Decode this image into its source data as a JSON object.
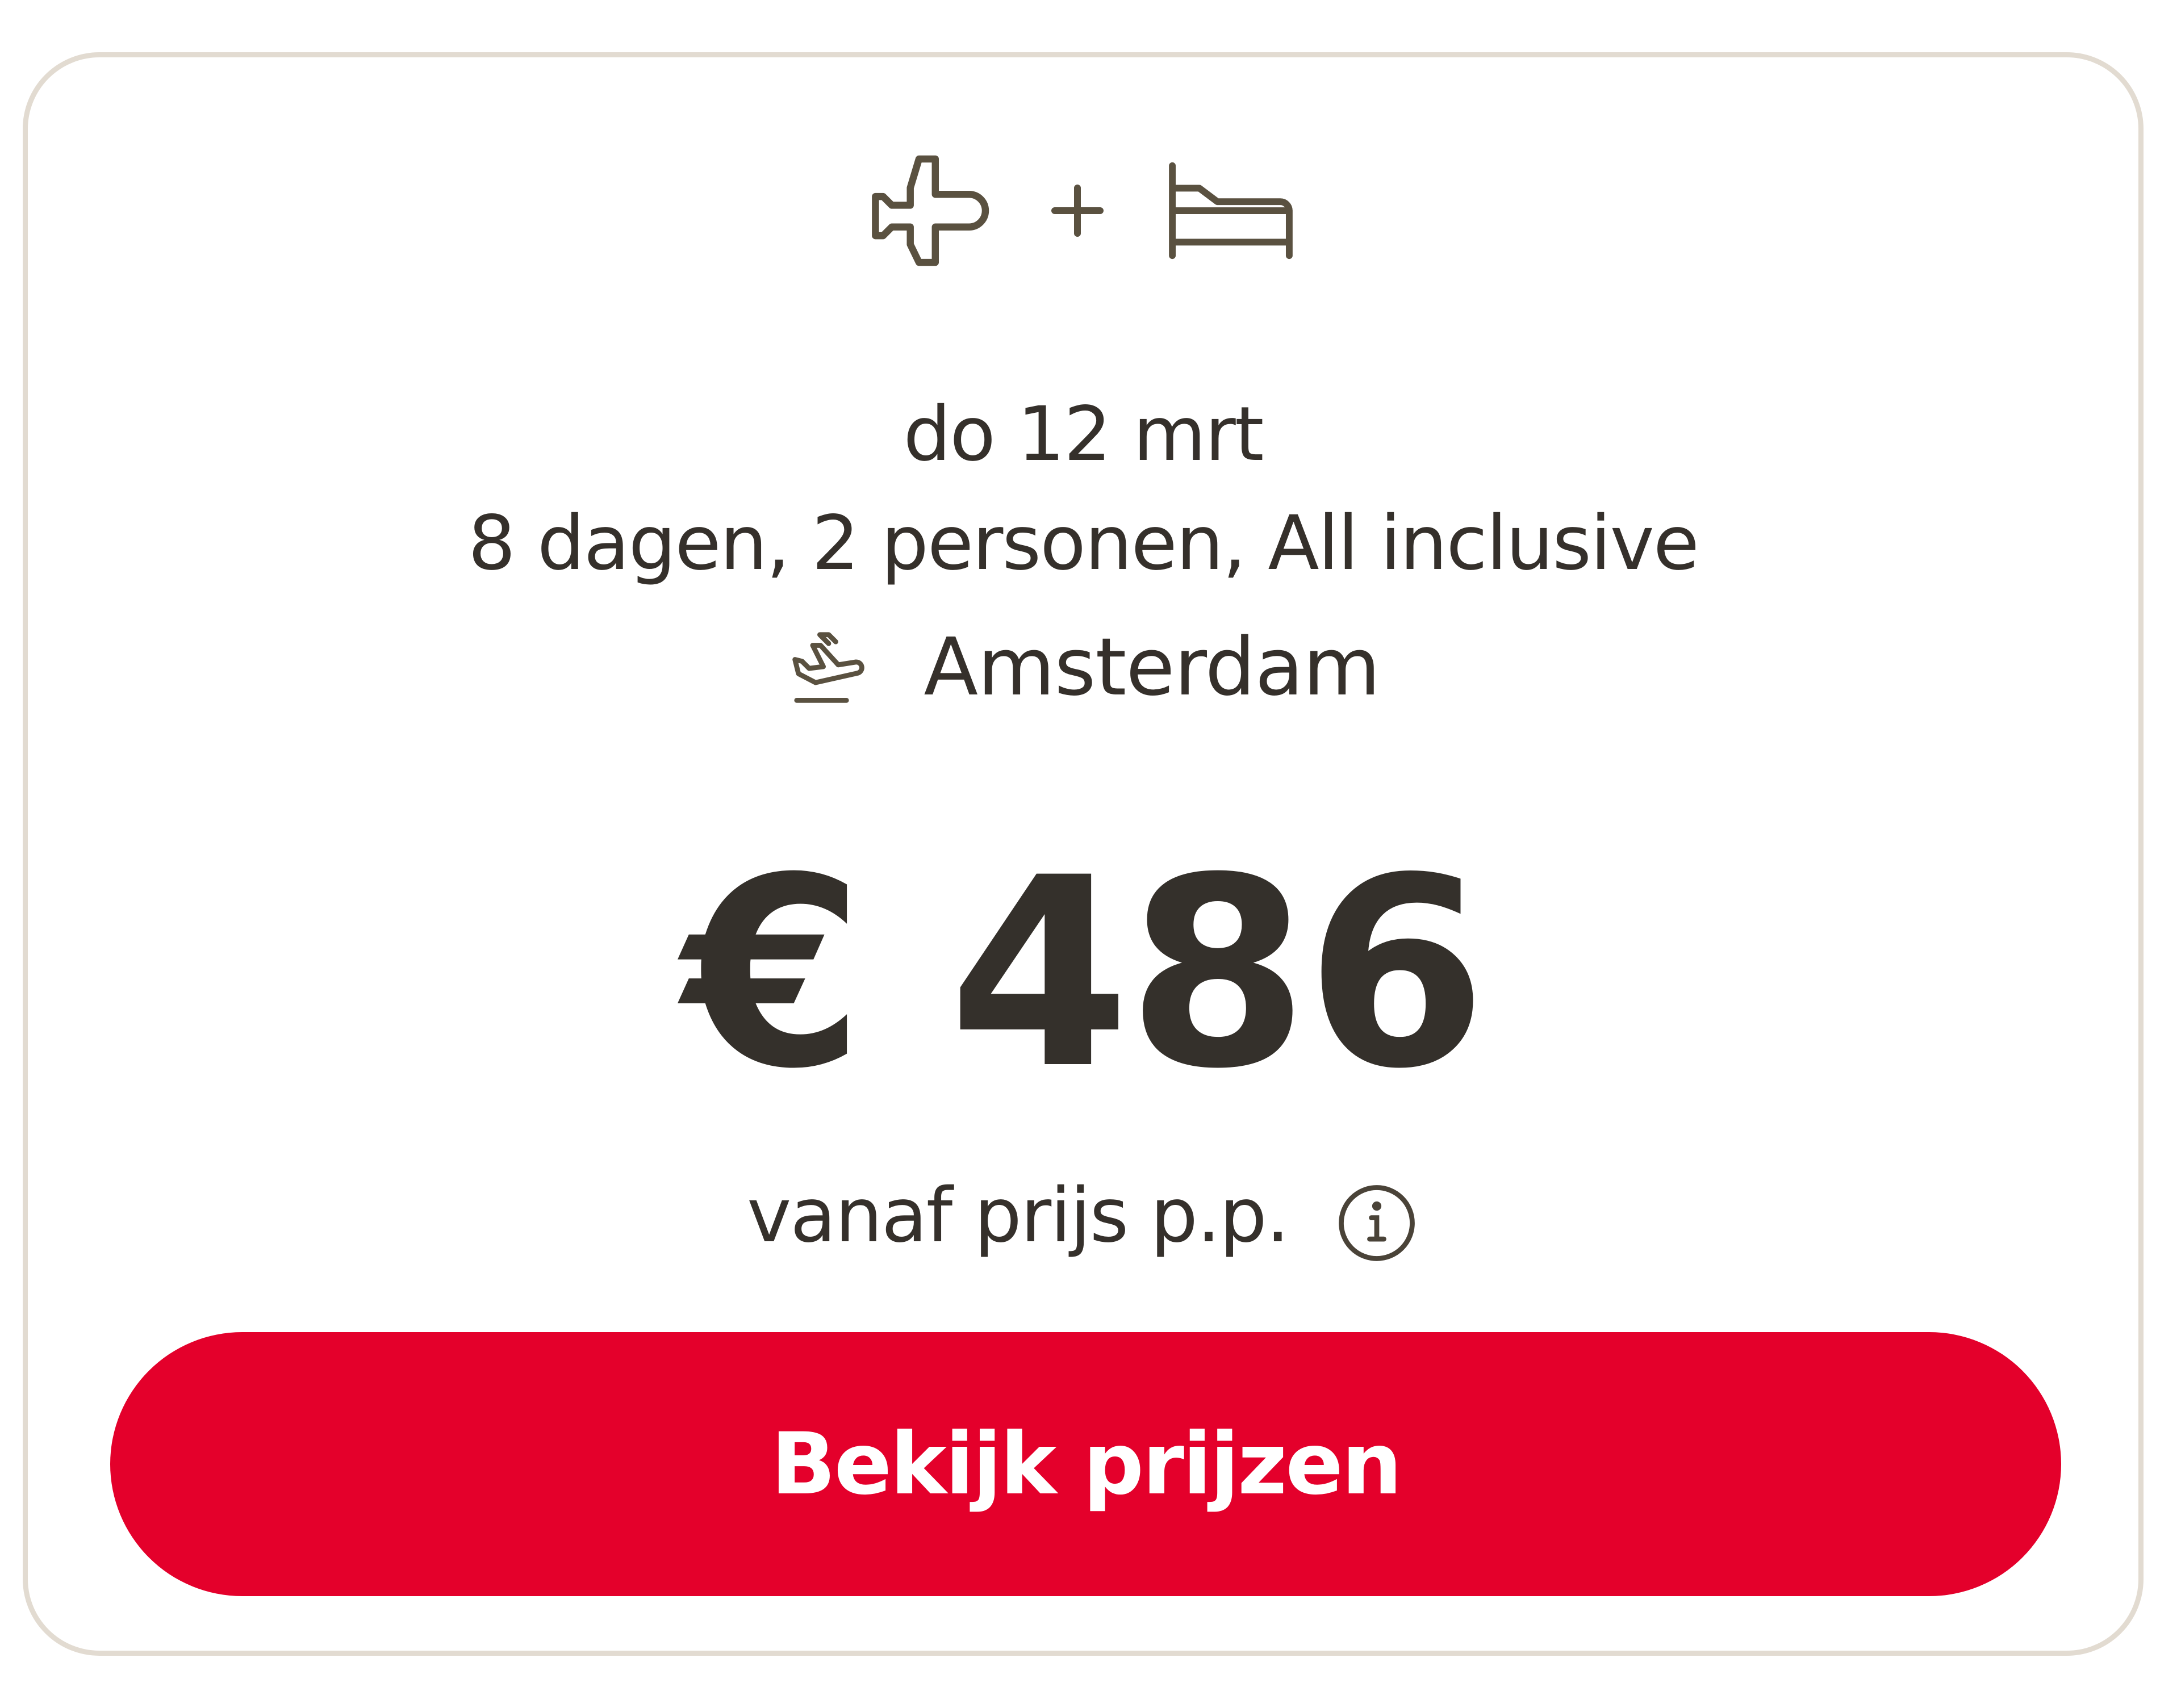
{
  "package": {
    "icons": [
      "airplane-icon",
      "plus-icon",
      "bed-icon"
    ]
  },
  "trip": {
    "date": "do 12 mrt",
    "details": "8 dagen, 2 personen, All inclusive",
    "departure_icon": "departure-plane-icon",
    "departure_airport": "Amsterdam"
  },
  "pricing": {
    "price": "€ 486",
    "price_note": "vanaf prijs p.p.",
    "info_icon": "info-icon"
  },
  "cta": {
    "label": "Bekijk prijzen"
  },
  "colors": {
    "accent": "#e4002b",
    "text": "#35302b",
    "icon": "#5a5140",
    "border": "#e2dbd1"
  }
}
